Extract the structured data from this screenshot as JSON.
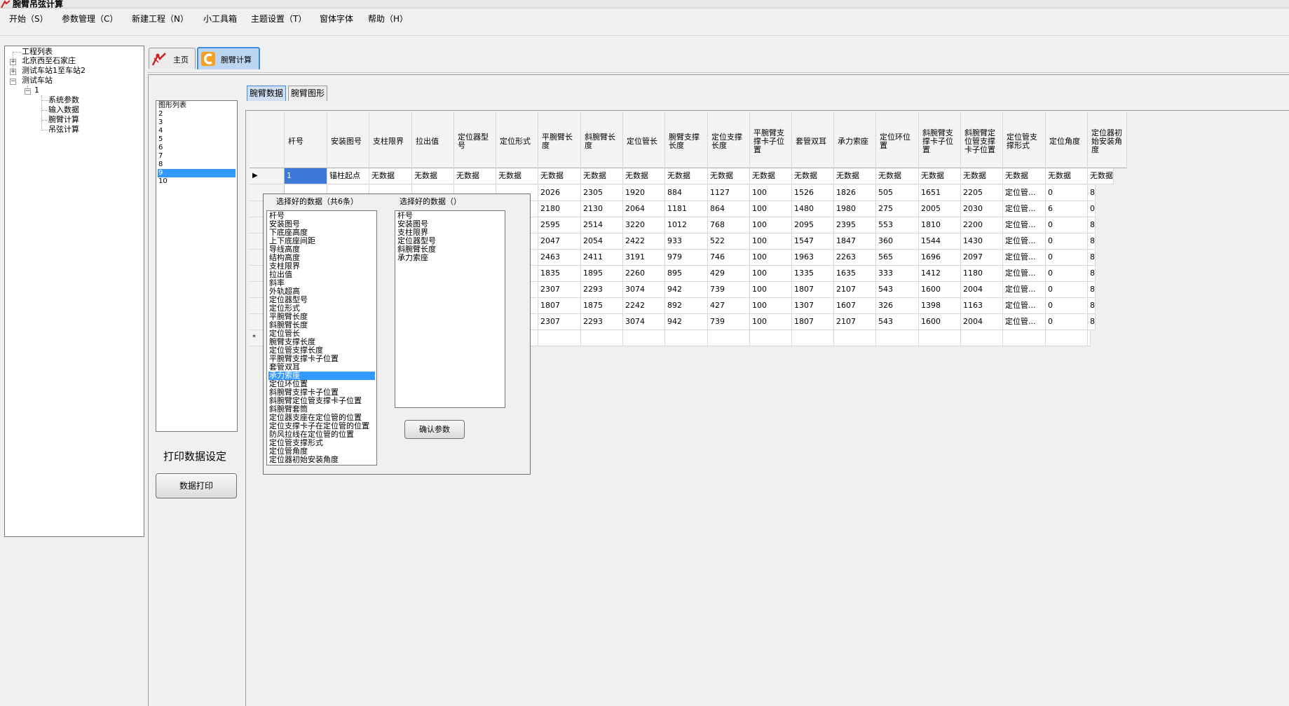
{
  "window": {
    "title": "腕臂吊弦计算"
  },
  "menu": [
    "开始（S）",
    "参数管理（C）",
    "新建工程（N）",
    "小工具箱",
    "主题设置（T）",
    "窗体字体",
    "帮助（H）"
  ],
  "tree": {
    "root": "工程列表",
    "nodes": [
      "北京西至石家庄",
      "测试车站1至车站2",
      "测试车站"
    ],
    "child": "1",
    "leaves": [
      "系统参数",
      "输入数据",
      "腕臂计算",
      "吊弦计算"
    ]
  },
  "tabs": [
    "主页",
    "腕臂计算"
  ],
  "subtabs": [
    "腕臂数据",
    "腕臂图形"
  ],
  "figure_list": {
    "items": [
      "图形列表",
      "2",
      "3",
      "4",
      "5",
      "6",
      "7",
      "8",
      "9",
      "10"
    ],
    "selected_index": 8
  },
  "print_section": {
    "label": "打印数据设定",
    "button": "数据打印"
  },
  "grid": {
    "headers": [
      "杆号",
      "安装图号",
      "支柱限界",
      "拉出值",
      "定位器型号",
      "定位形式",
      "平腕臂长度",
      "斜腕臂长度",
      "定位管长",
      "腕臂支撑长度",
      "定位支撑长度",
      "平腕臂支撑卡子位置",
      "套管双耳",
      "承力索座",
      "定位环位置",
      "斜腕臂支撑卡子位置",
      "斜腕臂定位管支撑卡子位置",
      "定位管支撑形式",
      "定位角度",
      "定位器初始安装角度"
    ],
    "first_row": [
      "1",
      "锚柱起点",
      "无数据",
      "无数据",
      "无数据",
      "无数据",
      "无数据",
      "无数据",
      "无数据",
      "无数据",
      "无数据",
      "无数据",
      "无数据",
      "无数据",
      "无数据",
      "无数据",
      "无数据",
      "无数据",
      "无数据",
      "无数据"
    ],
    "rows": [
      [
        "2026",
        "2305",
        "1920",
        "884",
        "1127",
        "100",
        "1526",
        "1826",
        "505",
        "1651",
        "2205",
        "定位管...",
        "0",
        "8"
      ],
      [
        "2180",
        "2130",
        "2064",
        "1181",
        "864",
        "100",
        "1480",
        "1980",
        "275",
        "2005",
        "2030",
        "定位管...",
        "6",
        "0"
      ],
      [
        "2595",
        "2514",
        "3220",
        "1012",
        "768",
        "100",
        "2095",
        "2395",
        "553",
        "1810",
        "2200",
        "定位管...",
        "0",
        "8"
      ],
      [
        "2047",
        "2054",
        "2422",
        "933",
        "522",
        "100",
        "1547",
        "1847",
        "360",
        "1544",
        "1430",
        "定位管...",
        "0",
        "8"
      ],
      [
        "2463",
        "2411",
        "3191",
        "979",
        "746",
        "100",
        "1963",
        "2263",
        "565",
        "1696",
        "2097",
        "定位管...",
        "0",
        "8"
      ],
      [
        "1835",
        "1895",
        "2260",
        "895",
        "429",
        "100",
        "1335",
        "1635",
        "333",
        "1412",
        "1180",
        "定位管...",
        "0",
        "8"
      ],
      [
        "2307",
        "2293",
        "3074",
        "942",
        "739",
        "100",
        "1807",
        "2107",
        "543",
        "1600",
        "2004",
        "定位管...",
        "0",
        "8"
      ],
      [
        "1807",
        "1875",
        "2242",
        "892",
        "427",
        "100",
        "1307",
        "1607",
        "326",
        "1398",
        "1163",
        "定位管...",
        "0",
        "8"
      ],
      [
        "2307",
        "2293",
        "3074",
        "942",
        "739",
        "100",
        "1807",
        "2107",
        "543",
        "1600",
        "2004",
        "定位管...",
        "0",
        "8"
      ]
    ],
    "row_marker_current": "▶",
    "row_marker_new": "*"
  },
  "popup": {
    "left_title": "选择好的数据（共6条）",
    "right_title": "选择好的数据（）",
    "left_items": [
      "杆号",
      "安装图号",
      "下底座高度",
      "上下底座间距",
      "导线高度",
      "结构高度",
      "支柱限界",
      "拉出值",
      "斜率",
      "外轨超高",
      "定位器型号",
      "定位形式",
      "平腕臂长度",
      "斜腕臂长度",
      "定位管长",
      "腕臂支撑长度",
      "定位管支撑长度",
      "平腕臂支撑卡子位置",
      "套管双耳",
      "承力索座",
      "定位环位置",
      "斜腕臂支撑卡子位置",
      "斜腕臂定位管支撑卡子位置",
      "斜腕臂套筒",
      "定位器支座在定位管的位置",
      "定位支撑卡子在定位管的位置",
      "防风拉线在定位管的位置",
      "定位管支撑形式",
      "定位管角度",
      "定位器初始安装角度"
    ],
    "left_selected": 19,
    "right_items": [
      "杆号",
      "安装图号",
      "支柱限界",
      "定位器型号",
      "斜腕臂长度",
      "承力索座"
    ],
    "confirm": "确认参数"
  },
  "colors": {
    "selection": "#3399ff",
    "grid_selection": "#3c78d8",
    "active_tab": "#3c8ce0"
  }
}
